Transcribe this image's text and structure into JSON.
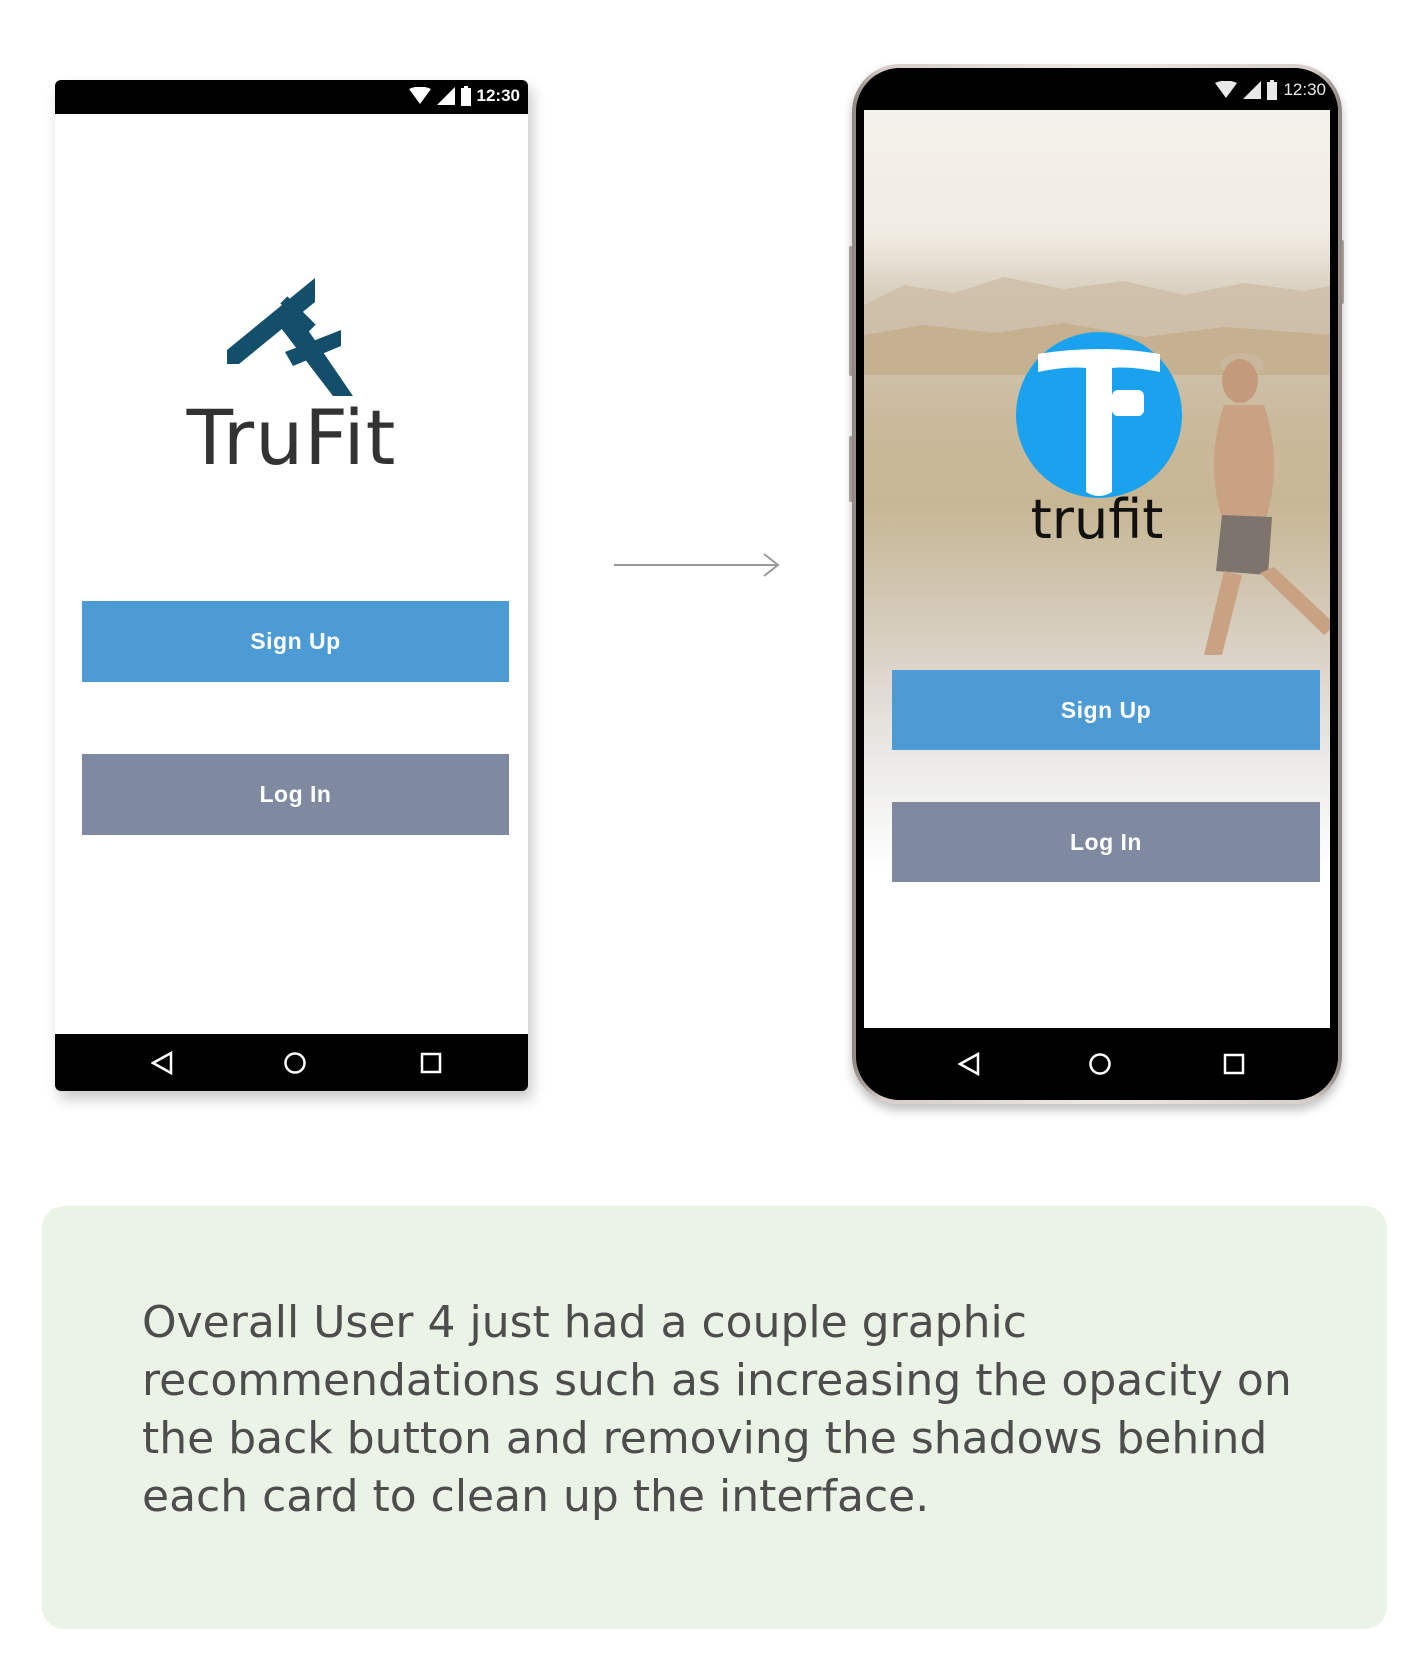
{
  "status_bar": {
    "time": "12:30"
  },
  "before_screen": {
    "logo_text": "TruFit",
    "signup_label": "Sign Up",
    "login_label": "Log In"
  },
  "after_screen": {
    "logo_text": "trufit",
    "signup_label": "Sign Up",
    "login_label": "Log In"
  },
  "caption": {
    "text": "Overall User 4 just had a couple graphic recommendations such as increasing the opacity on the back button and removing the shadows behind each card to clean up the interface."
  },
  "colors": {
    "signup_button": "#4d9bd5",
    "login_button": "#7f8aa1",
    "logo_mark": "#134e6b",
    "logo_circle": "#1ba2ee",
    "caption_background": "#eaf3e5"
  }
}
